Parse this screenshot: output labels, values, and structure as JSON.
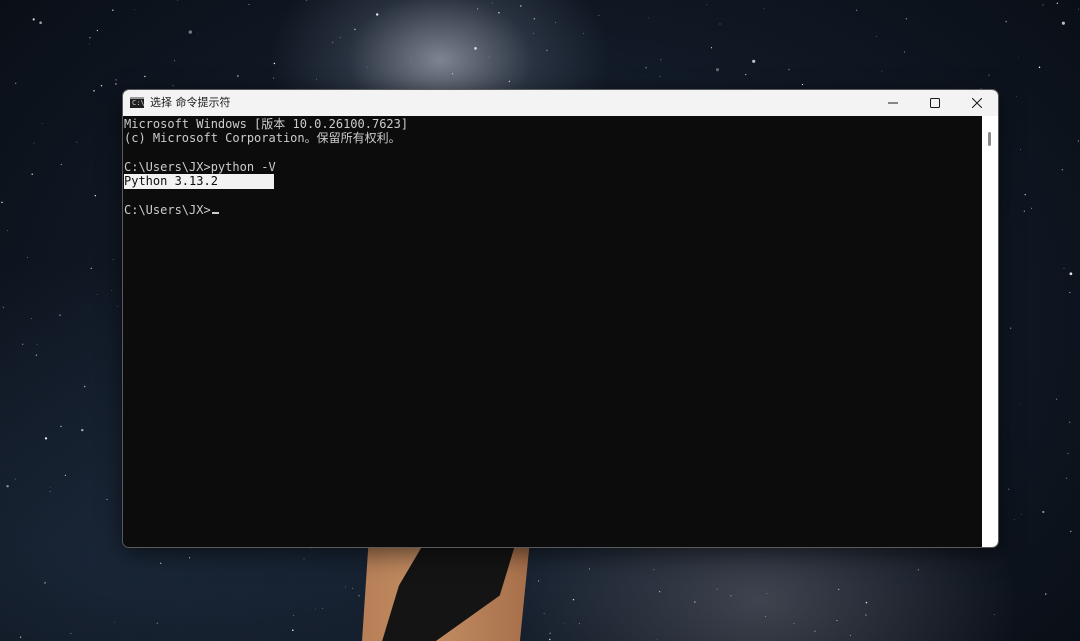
{
  "window": {
    "title": "选择 命令提示符",
    "icon": "cmd-icon",
    "icon_glyph": "C:\\",
    "controls": [
      "minimize-icon",
      "maximize-icon",
      "close-icon"
    ]
  },
  "console": {
    "lines": [
      "Microsoft Windows [版本 10.0.26100.7623]",
      "(c) Microsoft Corporation。保留所有权利。",
      "",
      "C:\\Users\\JX>python -V",
      "Python 3.13.2",
      "",
      "C:\\Users\\JX>"
    ],
    "selected_line_index": 4,
    "cursor": "_"
  },
  "colors": {
    "console_bg": "#0c0c0c",
    "console_text": "#cccccc",
    "selection_bg": "#f2f2f2",
    "titlebar_bg": "#f3f3f3"
  }
}
